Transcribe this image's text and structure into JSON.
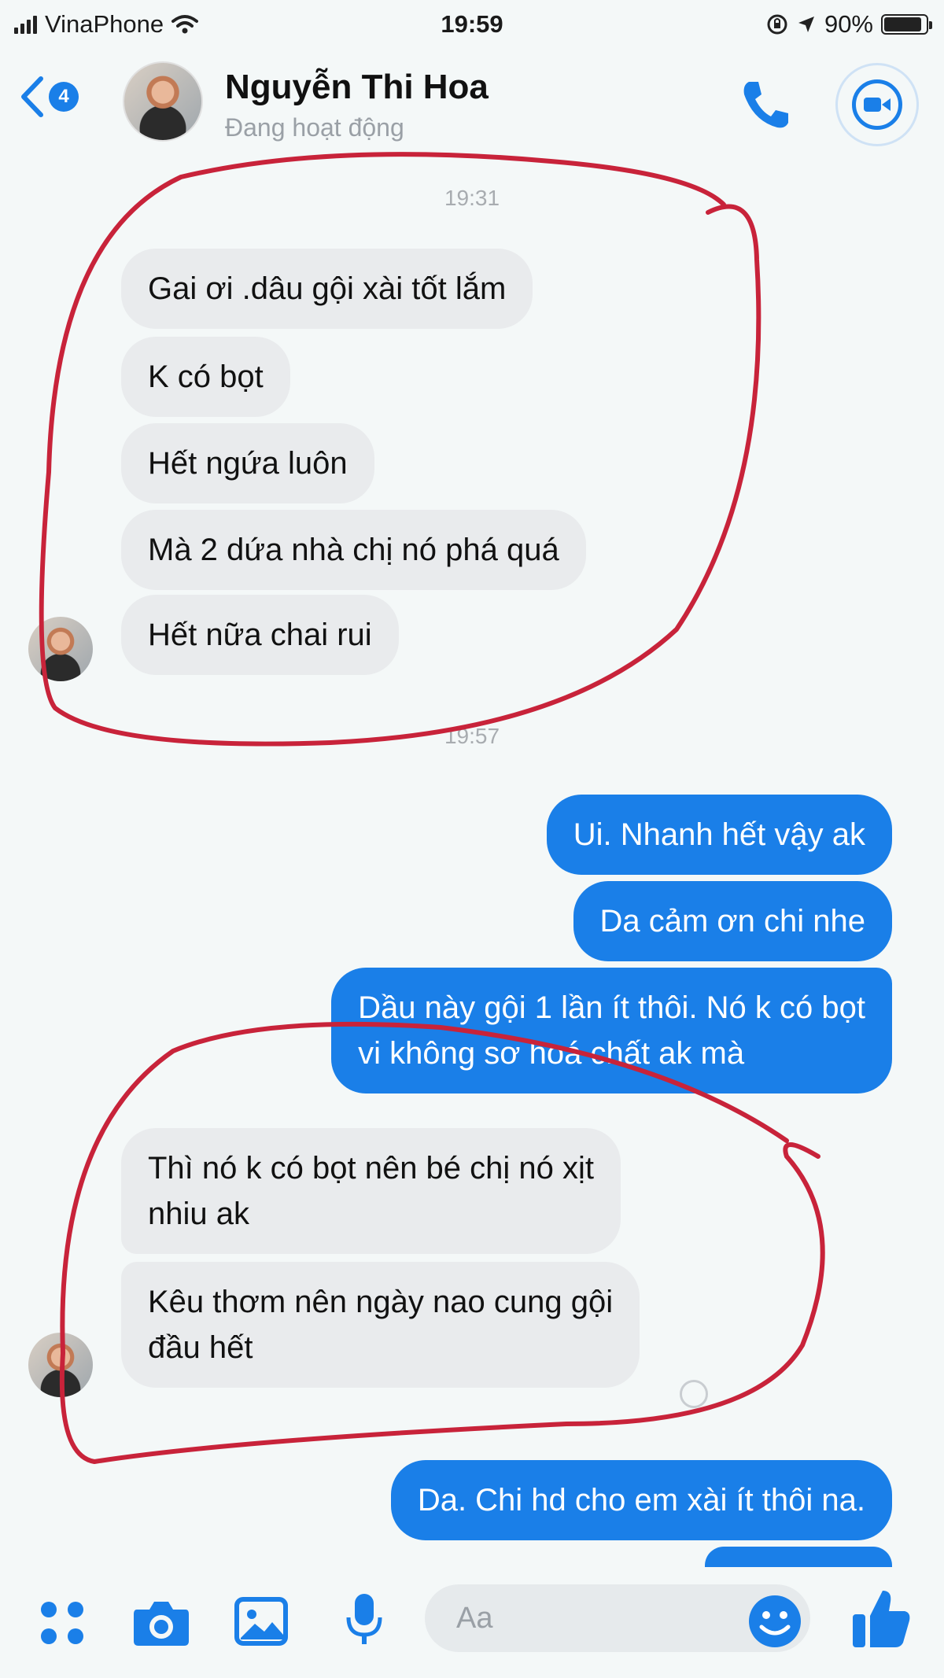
{
  "status_bar": {
    "carrier": "VinaPhone",
    "time": "19:59",
    "battery": "90%",
    "battery_level": 0.9
  },
  "header": {
    "back_count": "4",
    "contact_name": "Nguyễn Thi Hoa",
    "contact_status": "Đang hoạt động"
  },
  "chat": {
    "timestamp_1": "19:31",
    "timestamp_2": "19:57",
    "messages": [
      {
        "from": "in",
        "text": "Gai ơi .dâu gội xài tốt lắm"
      },
      {
        "from": "in",
        "text": "K có bọt"
      },
      {
        "from": "in",
        "text": "Hết ngứa luôn"
      },
      {
        "from": "in",
        "text": "Mà 2 dứa nhà chị nó phá quá"
      },
      {
        "from": "in",
        "text": "Hết nữa chai rui"
      },
      {
        "from": "out",
        "text": "Ui. Nhanh hết vậy ak"
      },
      {
        "from": "out",
        "text": "Da cảm ơn chi nhe"
      },
      {
        "from": "out",
        "lines": [
          "Dầu này gội 1 lần ít thôi. Nó k có bọt",
          "vi không sơ hoá chất ak mà"
        ]
      },
      {
        "from": "in",
        "lines": [
          "Thì nó k có bọt nên bé chị nó xịt",
          "nhiu ak"
        ]
      },
      {
        "from": "in",
        "lines": [
          "Kêu thơm nên ngày nao cung gội",
          "đầu hết"
        ]
      },
      {
        "from": "out",
        "text": "Da. Chi hd cho em xài ít thôi na."
      }
    ]
  },
  "composer": {
    "placeholder": "Aa"
  },
  "colors": {
    "accent": "#1a7fe8",
    "incoming_bubble": "#e9ebed",
    "annotation": "#c8233a"
  }
}
